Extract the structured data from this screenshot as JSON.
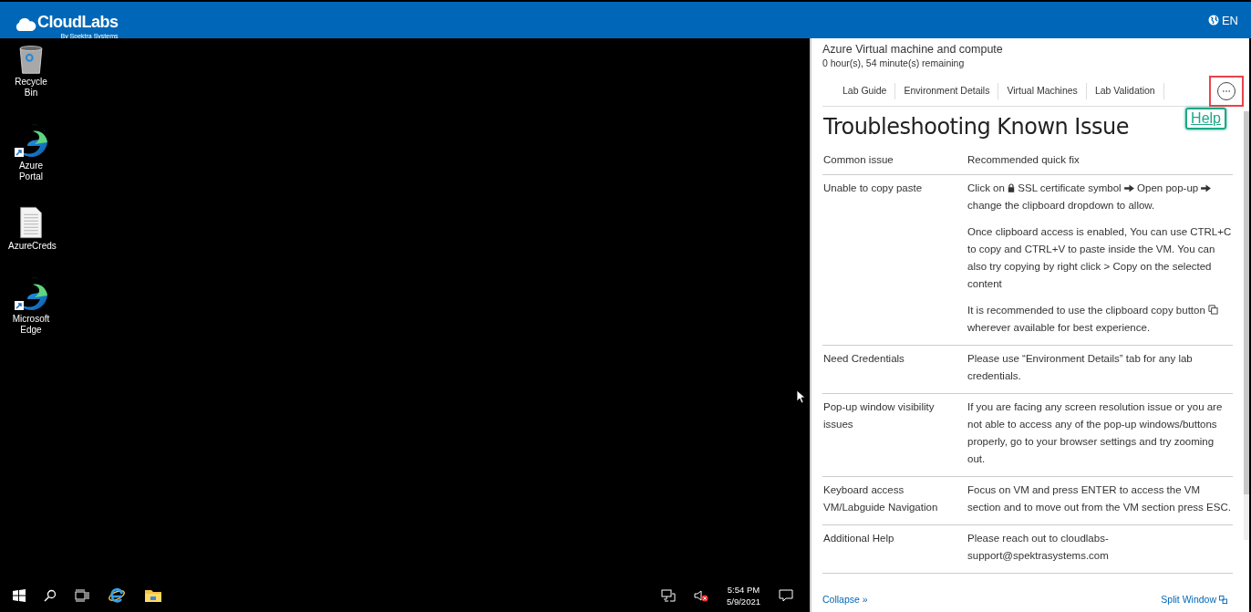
{
  "header": {
    "logo": "CloudLabs",
    "logo_sub": "By Spektra Systems",
    "language": "EN"
  },
  "desktop": {
    "icons": [
      {
        "kind": "recycle",
        "label": "Recycle Bin"
      },
      {
        "kind": "edge",
        "label": "Azure Portal"
      },
      {
        "kind": "doc",
        "label": "AzureCreds"
      },
      {
        "kind": "edge",
        "label": "Microsoft Edge"
      }
    ]
  },
  "taskbar": {
    "time": "5:54 PM",
    "date": "5/9/2021"
  },
  "panel": {
    "title": "Azure Virtual machine and compute",
    "remaining": "0 hour(s), 54 minute(s) remaining",
    "tabs": [
      {
        "label": "Lab Guide",
        "selected": false
      },
      {
        "label": "Environment Details",
        "selected": false
      },
      {
        "label": "Virtual Machines",
        "selected": false
      },
      {
        "label": "Lab Validation",
        "selected": false
      }
    ],
    "more_tooltip": "Help",
    "heading": "Troubleshooting Known Issue",
    "table": {
      "columns": [
        "Common issue",
        "Recommended quick fix"
      ],
      "rows": [
        {
          "issue": "Unable to copy paste",
          "fix": [
            [
              {
                "kind": "text",
                "text": "Click on"
              },
              {
                "kind": "lock"
              },
              {
                "kind": "text",
                "text": "SSL certificate symbol"
              },
              {
                "kind": "arrow"
              },
              {
                "kind": "text",
                "text": "Open pop-up"
              },
              {
                "kind": "arrow"
              },
              {
                "kind": "text",
                "text": "change the clipboard dropdown to allow."
              }
            ],
            [
              {
                "kind": "text",
                "text": "Once clipboard access is enabled, You can use CTRL+C to copy and CTRL+V to paste inside the VM. You can also try copying by right click > Copy on the selected content"
              }
            ],
            [
              {
                "kind": "text",
                "text": "It is recommended to use the clipboard copy button"
              },
              {
                "kind": "copy"
              },
              {
                "kind": "text",
                "text": "wherever available for best experience."
              }
            ]
          ]
        },
        {
          "issue": "Need Credentials",
          "fix": [
            [
              {
                "kind": "text",
                "text": "Please use “Environment Details” tab for any lab credentials."
              }
            ]
          ]
        },
        {
          "issue": "Pop-up window visibility issues",
          "fix": [
            [
              {
                "kind": "text",
                "text": "If you are facing any screen resolution issue or you are not able to access any of the pop-up windows/buttons properly, go to your browser settings and try zooming out."
              }
            ]
          ]
        },
        {
          "issue": "Keyboard access VM/Labguide Navigation",
          "fix": [
            [
              {
                "kind": "text",
                "text": "Focus on VM and press ENTER to access the VM section and to move out from the VM section press ESC."
              }
            ]
          ]
        },
        {
          "issue": "Additional Help",
          "fix": [
            [
              {
                "kind": "text",
                "text": "Please reach out to cloudlabs-support@spektrasystems.com"
              }
            ]
          ]
        }
      ]
    },
    "collapse": "Collapse »",
    "split": "Split Window"
  }
}
